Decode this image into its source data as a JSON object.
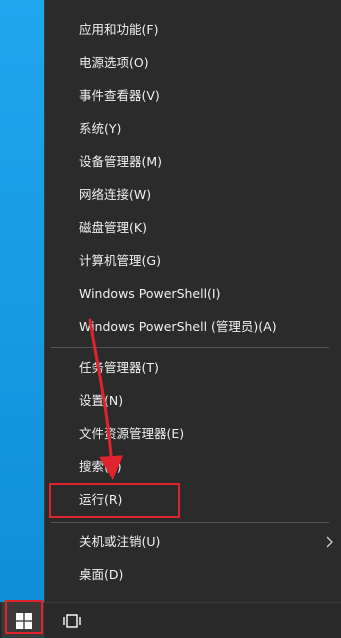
{
  "menu": {
    "items": [
      {
        "label": "应用和功能(F)"
      },
      {
        "label": "电源选项(O)"
      },
      {
        "label": "事件查看器(V)"
      },
      {
        "label": "系统(Y)"
      },
      {
        "label": "设备管理器(M)"
      },
      {
        "label": "网络连接(W)"
      },
      {
        "label": "磁盘管理(K)"
      },
      {
        "label": "计算机管理(G)"
      },
      {
        "label": "Windows PowerShell(I)"
      },
      {
        "label": "Windows PowerShell (管理员)(A)"
      },
      {
        "label": "任务管理器(T)"
      },
      {
        "label": "设置(N)"
      },
      {
        "label": "文件资源管理器(E)"
      },
      {
        "label": "搜索(S)"
      },
      {
        "label": "运行(R)"
      },
      {
        "label": "关机或注销(U)"
      },
      {
        "label": "桌面(D)"
      }
    ]
  },
  "icons": {
    "submenu": "chevron-right-icon",
    "start": "windows-logo-icon",
    "task_view": "task-view-icon"
  },
  "colors": {
    "menu_bg": "#2b2b2b",
    "desktop_bg": "#1aa0e8",
    "highlight": "#e0242d",
    "text": "#f0f0f0"
  }
}
